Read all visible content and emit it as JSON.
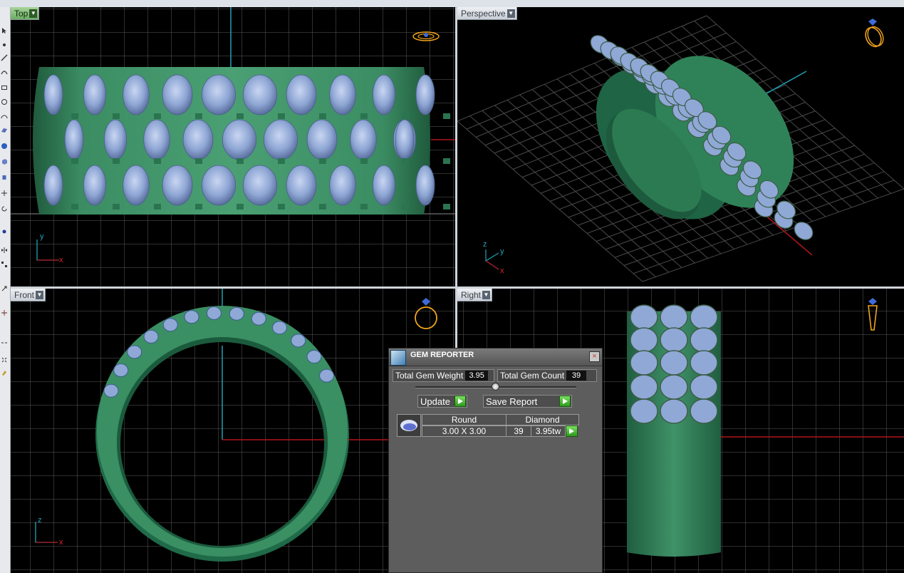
{
  "viewports": {
    "top": {
      "label": "Top"
    },
    "perspective": {
      "label": "Perspective"
    },
    "front": {
      "label": "Front"
    },
    "right": {
      "label": "Right"
    }
  },
  "axes": {
    "top": {
      "a": "y",
      "b": "x"
    },
    "perspective": {
      "a": "z",
      "b": "y",
      "c": "x"
    },
    "front": {
      "a": "z",
      "b": "x"
    }
  },
  "gem_reporter": {
    "title": "GEM REPORTER",
    "close": "×",
    "total_weight_label": "Total Gem Weight",
    "total_weight_value": "3.95",
    "total_count_label": "Total Gem Count",
    "total_count_value": "39",
    "update_label": "Update",
    "save_label": "Save Report",
    "gem": {
      "shape": "Round",
      "material": "Diamond",
      "size": "3.00 X 3.00",
      "count": "39",
      "weight": "3.95tw"
    }
  },
  "colors": {
    "band": "#2f7a55",
    "gem": "#8fa8d6",
    "grid": "#5c5c5c",
    "axis_x": "#b0161a",
    "axis_y": "#21a0b5",
    "icon": "#f2a51c"
  }
}
